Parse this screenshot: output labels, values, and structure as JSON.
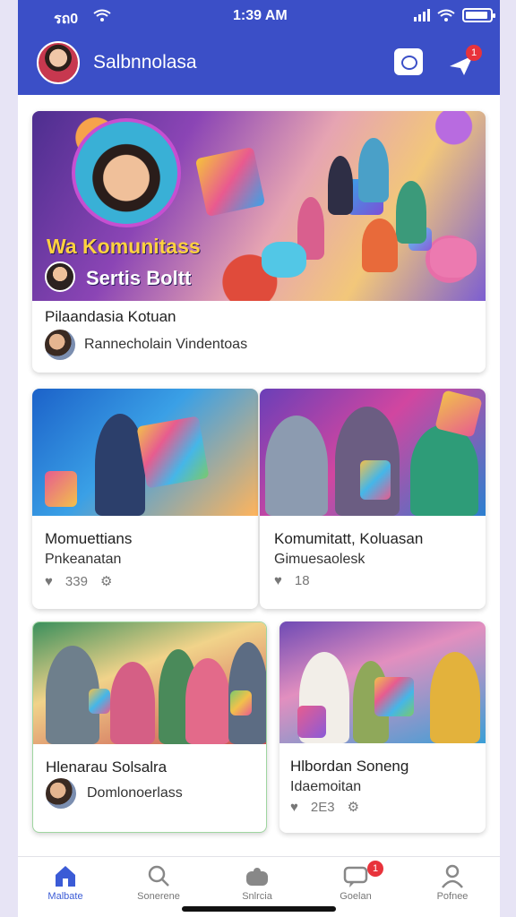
{
  "status_bar": {
    "carrier": "รถ0",
    "time": "1:39 AM"
  },
  "header": {
    "title": "Salbnnolasa",
    "notification_count": "1"
  },
  "hero": {
    "caption_line1": "Wa Komunitass",
    "caption_line2": "Sertis Boltt",
    "title": "Pilaandasia Kotuan",
    "subtitle": "Rannecholain Vindentoas"
  },
  "cards": [
    {
      "title": "Momuettians",
      "subtitle": "Pnkeanatan",
      "likes": "339"
    },
    {
      "title": "Komumitatt, Koluasan",
      "subtitle": "Gimuesaolesk",
      "likes": "18"
    },
    {
      "title": "Hlenarau Solsalra",
      "subtitle": "Domlonoerlass"
    },
    {
      "title": "Hlbordan Soneng",
      "subtitle": "Idaemoitan",
      "likes": "2E3"
    }
  ],
  "nav": {
    "items": [
      {
        "label": "Malbate",
        "icon": "home-icon"
      },
      {
        "label": "Sonerene",
        "icon": "search-icon"
      },
      {
        "label": "Snlrcia",
        "icon": "store-icon"
      },
      {
        "label": "Goelan",
        "icon": "chat-icon",
        "badge": "1"
      },
      {
        "label": "Pofnee",
        "icon": "profile-icon"
      }
    ]
  },
  "colors": {
    "primary": "#3b4fc7",
    "accent": "#3b5bd6",
    "badge": "#e8333b"
  }
}
